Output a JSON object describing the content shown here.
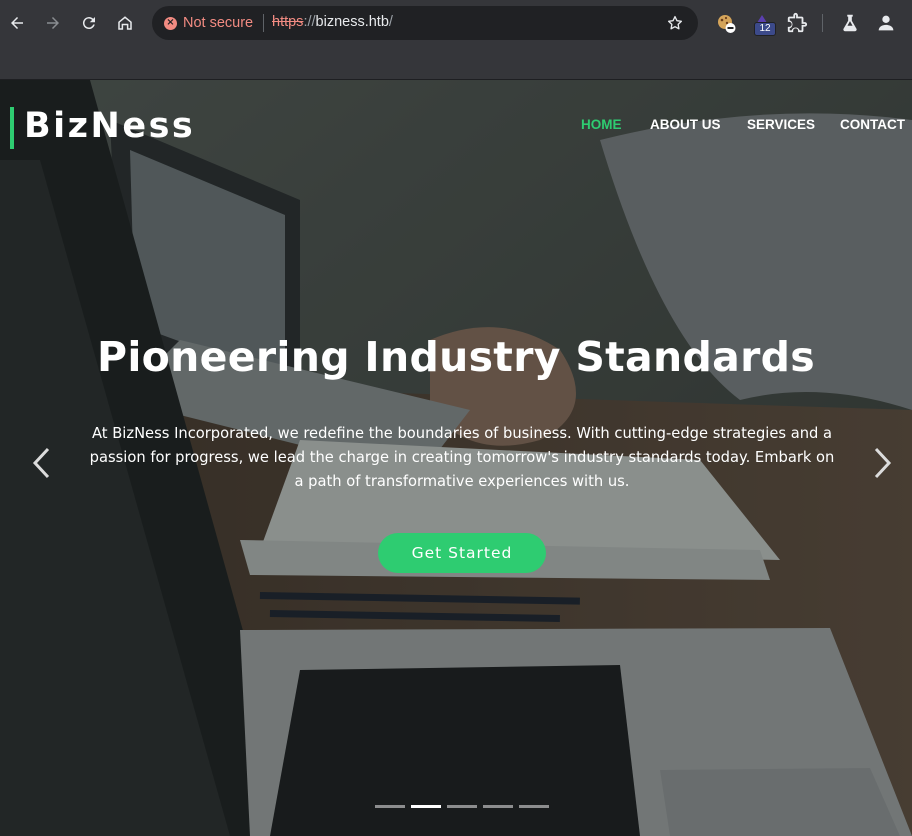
{
  "browser": {
    "security_label": "Not secure",
    "url_scheme": "https",
    "url_separator": "://",
    "url_host": "bizness.htb",
    "url_path": "/",
    "extension_badge": "12",
    "icons": [
      "back-icon",
      "forward-icon",
      "reload-icon",
      "home-icon",
      "star-icon",
      "extension-cookie-icon",
      "extension-badge-icon",
      "puzzle-icon",
      "labs-icon",
      "profile-icon"
    ]
  },
  "site": {
    "brand": "BizNess",
    "nav": [
      {
        "label": "HOME",
        "active": true
      },
      {
        "label": "ABOUT US",
        "active": false
      },
      {
        "label": "SERVICES",
        "active": false
      },
      {
        "label": "CONTACT",
        "active": false
      }
    ],
    "hero": {
      "title": "Pioneering Industry Standards",
      "description": "At BizNess Incorporated, we redefine the boundaries of business. With cutting-edge strategies and a passion for progress, we lead the charge in creating tomorrow's industry standards today. Embark on a path of transformative experiences with us.",
      "cta_label": "Get Started",
      "slide_count": 5,
      "active_slide": 2
    },
    "colors": {
      "accent": "#2ecc71",
      "text": "#ffffff"
    }
  }
}
